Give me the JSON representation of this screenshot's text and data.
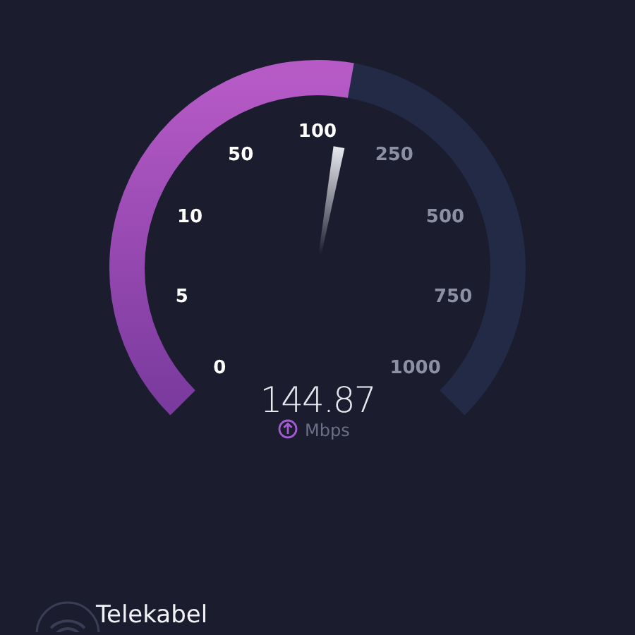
{
  "gauge": {
    "ticks": [
      {
        "label": "0",
        "passed": true
      },
      {
        "label": "5",
        "passed": true
      },
      {
        "label": "10",
        "passed": true
      },
      {
        "label": "50",
        "passed": true
      },
      {
        "label": "100",
        "passed": true
      },
      {
        "label": "250",
        "passed": false
      },
      {
        "label": "500",
        "passed": false
      },
      {
        "label": "750",
        "passed": false
      },
      {
        "label": "1000",
        "passed": false
      }
    ],
    "value": "144.87",
    "unit": "Mbps"
  },
  "network": {
    "name": "Telekabel"
  }
}
